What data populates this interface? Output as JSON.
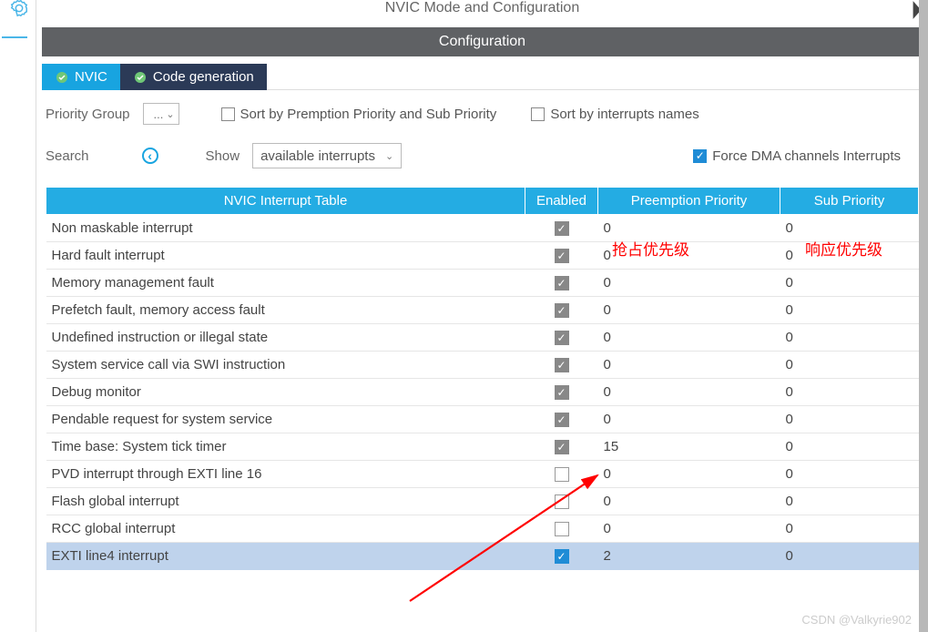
{
  "title": "NVIC Mode and Configuration",
  "banner": "Configuration",
  "tabs": {
    "nvic": "NVIC",
    "codegen": "Code generation"
  },
  "row1": {
    "priority_group_label": "Priority Group",
    "priority_group_value": "...",
    "sort_pp_label": "Sort by Premption Priority and Sub Priority",
    "sort_pp_checked": false,
    "sort_names_label": "Sort by interrupts names",
    "sort_names_checked": false
  },
  "row2": {
    "search_label": "Search",
    "show_label": "Show",
    "show_value": "available interrupts",
    "force_dma_label": "Force DMA channels Interrupts",
    "force_dma_checked": true
  },
  "table": {
    "headers": {
      "name": "NVIC Interrupt Table",
      "enabled": "Enabled",
      "preempt": "Preemption Priority",
      "sub": "Sub Priority"
    },
    "rows": [
      {
        "name": "Non maskable interrupt",
        "cb": "on-gray",
        "pre": "0",
        "sub": "0",
        "dim": true,
        "sel": false
      },
      {
        "name": "Hard fault interrupt",
        "cb": "on-gray",
        "pre": "0",
        "sub": "0",
        "dim": true,
        "sel": false
      },
      {
        "name": "Memory management fault",
        "cb": "on-gray",
        "pre": "0",
        "sub": "0",
        "dim": false,
        "sel": false
      },
      {
        "name": "Prefetch fault, memory access fault",
        "cb": "on-gray",
        "pre": "0",
        "sub": "0",
        "dim": false,
        "sel": false
      },
      {
        "name": "Undefined instruction or illegal state",
        "cb": "on-gray",
        "pre": "0",
        "sub": "0",
        "dim": false,
        "sel": false
      },
      {
        "name": "System service call via SWI instruction",
        "cb": "on-gray",
        "pre": "0",
        "sub": "0",
        "dim": false,
        "sel": false
      },
      {
        "name": "Debug monitor",
        "cb": "on-gray",
        "pre": "0",
        "sub": "0",
        "dim": false,
        "sel": false
      },
      {
        "name": "Pendable request for system service",
        "cb": "on-gray",
        "pre": "0",
        "sub": "0",
        "dim": false,
        "sel": false
      },
      {
        "name": "Time base: System tick timer",
        "cb": "on-gray",
        "pre": "15",
        "sub": "0",
        "dim": false,
        "sel": false
      },
      {
        "name": "PVD interrupt through EXTI line 16",
        "cb": "off",
        "pre": "0",
        "sub": "0",
        "dim": false,
        "sel": false
      },
      {
        "name": "Flash global interrupt",
        "cb": "off",
        "pre": "0",
        "sub": "0",
        "dim": false,
        "sel": false
      },
      {
        "name": "RCC global interrupt",
        "cb": "off",
        "pre": "0",
        "sub": "0",
        "dim": false,
        "sel": false
      },
      {
        "name": "EXTI line4 interrupt",
        "cb": "on-blue",
        "pre": "2",
        "sub": "0",
        "dim": false,
        "sel": true
      }
    ]
  },
  "annotations": {
    "preempt_cn": "抢占优先级",
    "sub_cn": "响应优先级"
  },
  "watermark": "CSDN @Valkyrie902"
}
